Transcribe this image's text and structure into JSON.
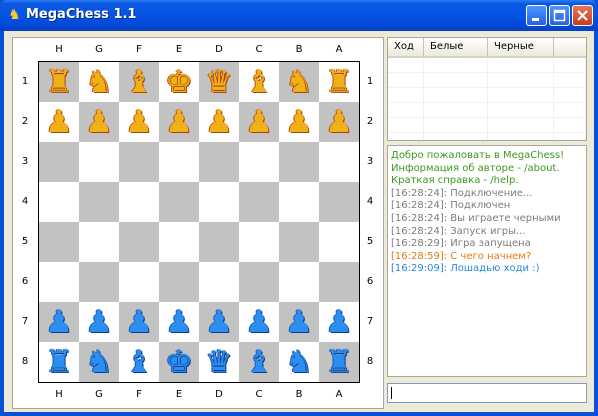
{
  "window": {
    "title": "MegaChess 1.1",
    "icon": "knight-app-icon"
  },
  "board": {
    "files_top": [
      "H",
      "G",
      "F",
      "E",
      "D",
      "C",
      "B",
      "A"
    ],
    "files_bottom": [
      "H",
      "G",
      "F",
      "E",
      "D",
      "C",
      "B",
      "A"
    ],
    "ranks_left": [
      "1",
      "2",
      "3",
      "4",
      "5",
      "6",
      "7",
      "8"
    ],
    "ranks_right": [
      "1",
      "2",
      "3",
      "4",
      "5",
      "6",
      "7",
      "8"
    ],
    "rows": [
      [
        "yR",
        "yN",
        "yB",
        "yK",
        "yQ",
        "yB",
        "yN",
        "yR"
      ],
      [
        "yP",
        "yP",
        "yP",
        "yP",
        "yP",
        "yP",
        "yP",
        "yP"
      ],
      [
        "",
        "",
        "",
        "",
        "",
        "",
        "",
        ""
      ],
      [
        "",
        "",
        "",
        "",
        "",
        "",
        "",
        ""
      ],
      [
        "",
        "",
        "",
        "",
        "",
        "",
        "",
        ""
      ],
      [
        "",
        "",
        "",
        "",
        "",
        "",
        "",
        ""
      ],
      [
        "bP",
        "bP",
        "bP",
        "bP",
        "bP",
        "bP",
        "bP",
        "bP"
      ],
      [
        "bR",
        "bN",
        "bB",
        "bK",
        "bQ",
        "bB",
        "bN",
        "bR"
      ]
    ],
    "colors": {
      "light": "#ffffff",
      "dark": "#c2c2c2",
      "yellow_pieces": "#f2b018",
      "blue_pieces": "#2c8ef0"
    }
  },
  "moves_table": {
    "headers": [
      "Ход",
      "Белые",
      "Черные"
    ],
    "rows": []
  },
  "chat": {
    "lines": [
      {
        "text": "Добро пожаловать в MegaChess!",
        "color": "#3c9a1c"
      },
      {
        "text": "Информация об авторе - /about.",
        "color": "#3c9a1c"
      },
      {
        "text": "Краткая справка - /help.",
        "color": "#3c9a1c"
      },
      {
        "text": "[16:28:24]: Подключение...",
        "color": "#7c7c7c"
      },
      {
        "text": "[16:28:24]: Подключен",
        "color": "#7c7c7c"
      },
      {
        "text": "[16:28:24]: Вы играете черными",
        "color": "#7c7c7c"
      },
      {
        "text": "[16:28:24]: Запуск игры...",
        "color": "#7c7c7c"
      },
      {
        "text": "[16:28:29]: Игра запущена",
        "color": "#7c7c7c"
      },
      {
        "text": "[16:28:59]: С чего начнем?",
        "color": "#e87a10"
      },
      {
        "text": "[16:29:09]: Лошадью ходи :)",
        "color": "#2a86e0"
      }
    ]
  },
  "message_input": {
    "value": ""
  }
}
